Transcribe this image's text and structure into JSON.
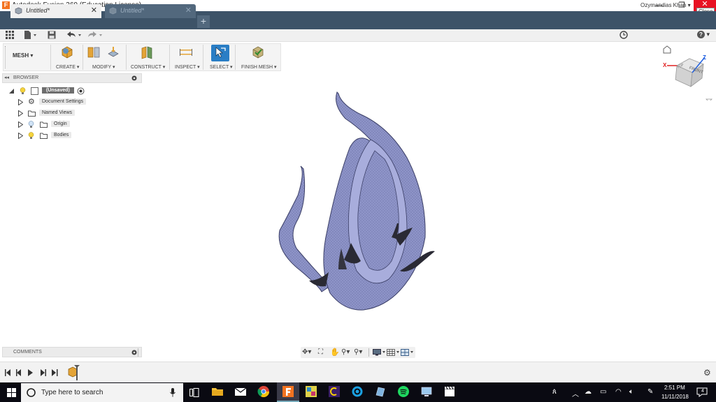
{
  "window": {
    "app_icon": "F",
    "title": "Autodesk Fusion 360 (Education License)",
    "minimize_label": "—",
    "restore_label": "❐",
    "close_label": "✕",
    "close_tooltip": "Close"
  },
  "tabs": [
    {
      "label": "Untitled*",
      "active": true
    },
    {
      "label": "Untitled*",
      "active": false
    }
  ],
  "tab_add_label": "+",
  "tab_close_label": "✕",
  "quick_access": {
    "user_name": "Ozymandias Khan ▾",
    "help_label": "? ▾"
  },
  "ribbon": {
    "workspace": "MESH ▾",
    "groups": [
      {
        "label": "CREATE ▾"
      },
      {
        "label": "MODIFY ▾"
      },
      {
        "label": "CONSTRUCT ▾"
      },
      {
        "label": "INSPECT ▾"
      },
      {
        "label": "SELECT ▾"
      },
      {
        "label": "FINISH MESH ▾"
      }
    ]
  },
  "browser": {
    "title": "BROWSER",
    "root_label": "(Unsaved)",
    "items": [
      {
        "label": "Document Settings",
        "icon": "gear-icon"
      },
      {
        "label": "Named Views",
        "icon": "folder-icon"
      },
      {
        "label": "Origin",
        "icon": "folder-icon"
      },
      {
        "label": "Bodies",
        "icon": "folder-icon"
      }
    ]
  },
  "comments": {
    "title": "COMMENTS"
  },
  "viewcube": {
    "front_label": "FRONT",
    "top_label": "TOP",
    "x_axis": "X",
    "z_axis": "Z"
  },
  "taskbar": {
    "search_placeholder": "Type here to search",
    "time": "2:51 PM",
    "date": "11/11/2018",
    "notifications": "4"
  },
  "colors": {
    "tabbar": "#3d5368",
    "mesh_fill": "#8e94c8",
    "close_red": "#e81123",
    "fusion_orange": "#f37321"
  }
}
